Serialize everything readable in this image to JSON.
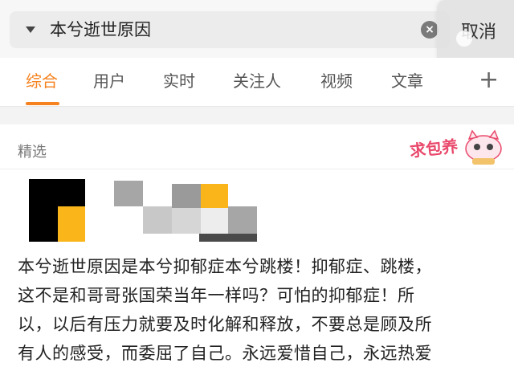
{
  "search": {
    "query": "本兮逝世原因",
    "cancel_label": "取消"
  },
  "tabs": [
    {
      "label": "综合"
    },
    {
      "label": "用户"
    },
    {
      "label": "实时"
    },
    {
      "label": "关注人"
    },
    {
      "label": "视频"
    },
    {
      "label": "文章"
    }
  ],
  "tabs_active_index": 0,
  "section": {
    "title": "精选",
    "sticker_text": "求包养"
  },
  "post": {
    "lines": [
      "本兮逝世原因是本兮抑郁症本兮跳楼！抑郁症、跳楼，",
      "这不是和哥哥张国荣当年一样吗？可怕的抑郁症！所",
      "以，以后有压力就要及时化解和释放，不要总是顾及所",
      "有人的感受，而委屈了自己。永远爱惜自己，永远热爱"
    ]
  },
  "colors": {
    "accent": "#f5821f",
    "sticker": "#e9486b"
  },
  "icons": [
    "dropdown-arrow-icon",
    "clear-icon",
    "plus-icon"
  ]
}
